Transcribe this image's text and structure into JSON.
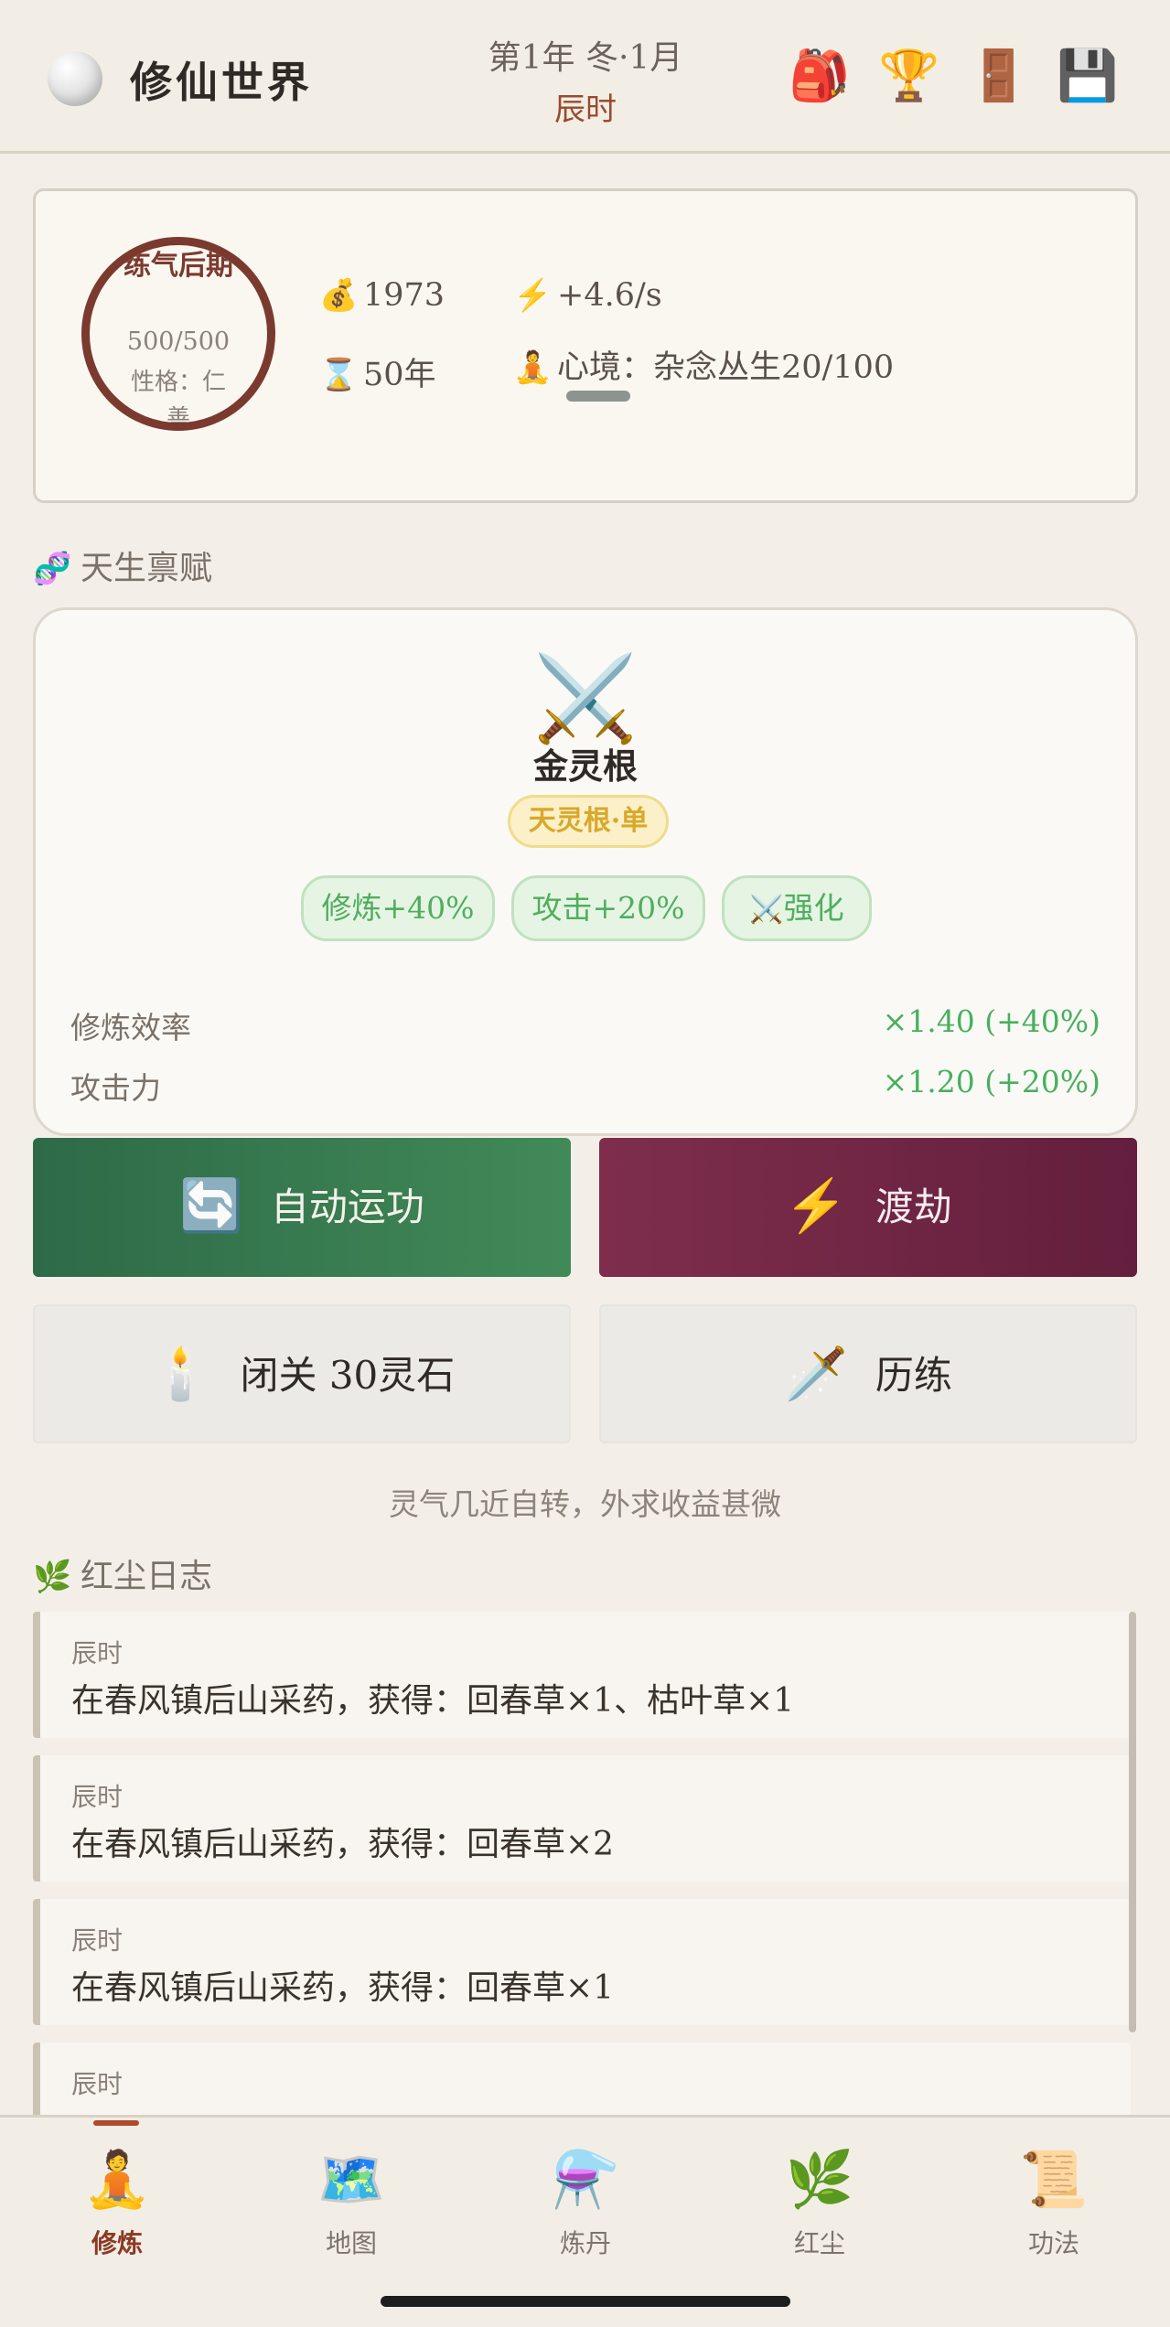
{
  "header": {
    "title": "修仙世界",
    "date": "第1年 冬·1月",
    "time": "辰时",
    "icons": [
      "backpack-icon",
      "trophy-icon",
      "door-icon",
      "save-icon"
    ]
  },
  "status": {
    "realm": "练气后期",
    "qi": "500/500",
    "trait": "性格：仁善",
    "spirit_stones": "1973",
    "rate": "+4.6/s",
    "age": "50年",
    "mind": "心境：杂念丛生20/100",
    "mind_progress": 0.2
  },
  "talent_section": {
    "title": "天生禀赋",
    "name": "金灵根",
    "grade": "天灵根·单",
    "tags": [
      "修炼+40%",
      "攻击+20%",
      "强化"
    ],
    "rows": [
      {
        "label": "修炼效率",
        "value": "×1.40 (+40%)"
      },
      {
        "label": "攻击力",
        "value": "×1.20 (+20%)"
      }
    ]
  },
  "actions": {
    "auto_cultivate": "自动运功",
    "tribulation": "渡劫",
    "seclusion": "闭关 30灵石",
    "adventure": "历练"
  },
  "hint": "灵气几近自转，外求收益甚微",
  "log_section": {
    "title": "红尘日志",
    "entries": [
      {
        "time": "辰时",
        "text": "在春风镇后山采药，获得：回春草×1、枯叶草×1"
      },
      {
        "time": "辰时",
        "text": "在春风镇后山采药，获得：回春草×2"
      },
      {
        "time": "辰时",
        "text": "在春风镇后山采药，获得：回春草×1"
      },
      {
        "time": "辰时",
        "text": ""
      }
    ]
  },
  "nav": [
    {
      "label": "修炼",
      "icon": "meditation-icon"
    },
    {
      "label": "地图",
      "icon": "map-icon"
    },
    {
      "label": "炼丹",
      "icon": "alembic-icon"
    },
    {
      "label": "红尘",
      "icon": "herb-icon"
    },
    {
      "label": "功法",
      "icon": "scroll-icon"
    }
  ],
  "colors": {
    "accent": "#8a3a24",
    "green": "#418a58",
    "crimson": "#7e2e4c"
  }
}
